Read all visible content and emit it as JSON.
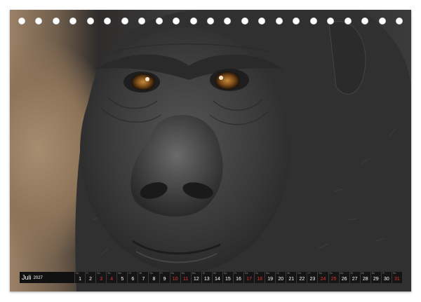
{
  "calendar": {
    "month": "Juli",
    "year": "2027",
    "days": [
      {
        "n": "1",
        "red": false
      },
      {
        "n": "2",
        "red": false
      },
      {
        "n": "3",
        "red": true
      },
      {
        "n": "4",
        "red": true
      },
      {
        "n": "5",
        "red": false
      },
      {
        "n": "6",
        "red": false
      },
      {
        "n": "7",
        "red": false
      },
      {
        "n": "8",
        "red": false
      },
      {
        "n": "9",
        "red": false
      },
      {
        "n": "10",
        "red": true
      },
      {
        "n": "11",
        "red": true
      },
      {
        "n": "12",
        "red": false
      },
      {
        "n": "13",
        "red": false
      },
      {
        "n": "14",
        "red": false
      },
      {
        "n": "15",
        "red": false
      },
      {
        "n": "16",
        "red": false
      },
      {
        "n": "17",
        "red": true
      },
      {
        "n": "18",
        "red": true
      },
      {
        "n": "19",
        "red": false
      },
      {
        "n": "20",
        "red": false
      },
      {
        "n": "21",
        "red": false
      },
      {
        "n": "22",
        "red": false
      },
      {
        "n": "23",
        "red": false
      },
      {
        "n": "24",
        "red": true
      },
      {
        "n": "25",
        "red": true
      },
      {
        "n": "26",
        "red": false
      },
      {
        "n": "27",
        "red": false
      },
      {
        "n": "28",
        "red": false
      },
      {
        "n": "29",
        "red": false
      },
      {
        "n": "30",
        "red": false
      },
      {
        "n": "31",
        "red": true
      }
    ],
    "weekday_abbrev": [
      "Do",
      "Fr",
      "Sa",
      "So",
      "Mo",
      "Di",
      "Mi"
    ]
  },
  "photo": {
    "subject": "gorilla-face",
    "colors": {
      "fur": "#2f2f2f",
      "skin": "#4a4a4a",
      "background": "#9b8166",
      "eyes": "#8a5a1e"
    }
  },
  "binding": {
    "hole_count": 23
  }
}
